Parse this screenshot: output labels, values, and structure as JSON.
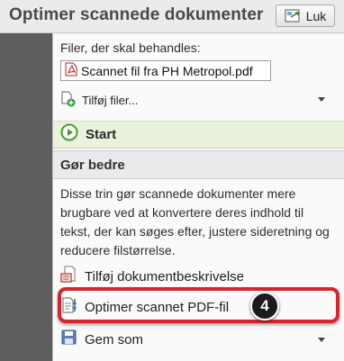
{
  "window": {
    "title": "Optimer scannede dokumenter",
    "close_label": "Luk"
  },
  "files": {
    "label": "Filer, der skal behandles:",
    "selected_file": "Scannet fil fra PH Metropol.pdf",
    "add_files_label": "Tilføj filer..."
  },
  "start": {
    "label": "Start"
  },
  "improve": {
    "heading": "Gør bedre",
    "description": "Disse trin gør scannede dokumenter mere brugbare ved at konvertere deres indhold til tekst, der kan søges efter, justere sideretning og reducere filstørrelse.",
    "tools": [
      {
        "label": "Tilføj dokumentbeskrivelse",
        "icon": "document-description-icon"
      },
      {
        "label": "Optimer scannet PDF-fil",
        "icon": "optimize-scan-icon"
      },
      {
        "label": "Gem som",
        "icon": "save-as-icon"
      }
    ]
  },
  "annotation": {
    "step_number": "4",
    "highlight_color": "#d6252e"
  }
}
